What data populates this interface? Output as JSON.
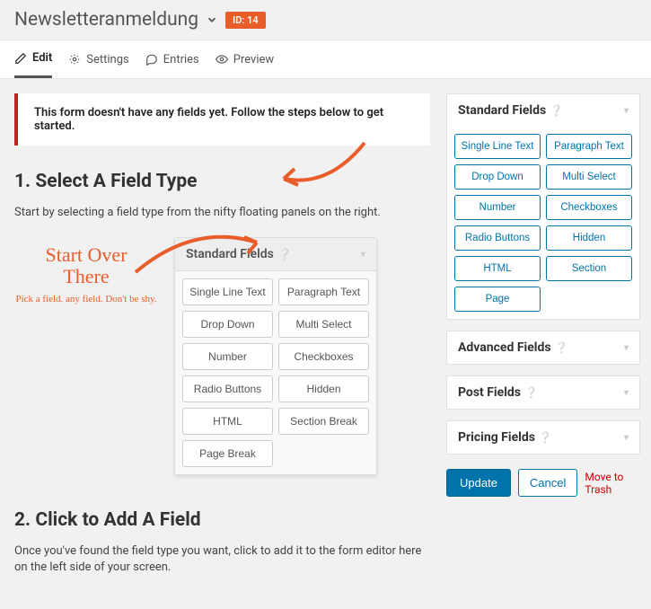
{
  "header": {
    "title": "Newsletteranmeldung",
    "idBadge": "ID: 14"
  },
  "tabs": {
    "edit": "Edit",
    "settings": "Settings",
    "entries": "Entries",
    "preview": "Preview"
  },
  "notice": "This form doesn't have any fields yet. Follow the steps below to get started.",
  "section1": {
    "heading": "1. Select A Field Type",
    "desc": "Start by selecting a field type from the nifty floating panels on the right."
  },
  "hand": {
    "line1": "Start Over",
    "line2": "There",
    "small": "Pick a field. any field. Don't be shy."
  },
  "illusPanel": {
    "title": "Standard Fields",
    "items": [
      "Single Line Text",
      "Paragraph Text",
      "Drop Down",
      "Multi Select",
      "Number",
      "Checkboxes",
      "Radio Buttons",
      "Hidden",
      "HTML",
      "Section Break",
      "Page Break"
    ]
  },
  "section2": {
    "heading": "2. Click to Add A Field",
    "desc": "Once you've found the field type you want, click to add it to the form editor here on the left side of your screen."
  },
  "sidebar": {
    "standard": {
      "title": "Standard Fields",
      "items": [
        "Single Line Text",
        "Paragraph Text",
        "Drop Down",
        "Multi Select",
        "Number",
        "Checkboxes",
        "Radio Buttons",
        "Hidden",
        "HTML",
        "Section",
        "Page"
      ]
    },
    "advanced": {
      "title": "Advanced Fields"
    },
    "post": {
      "title": "Post Fields"
    },
    "pricing": {
      "title": "Pricing Fields"
    }
  },
  "actions": {
    "update": "Update",
    "cancel": "Cancel",
    "trash": "Move to Trash"
  }
}
